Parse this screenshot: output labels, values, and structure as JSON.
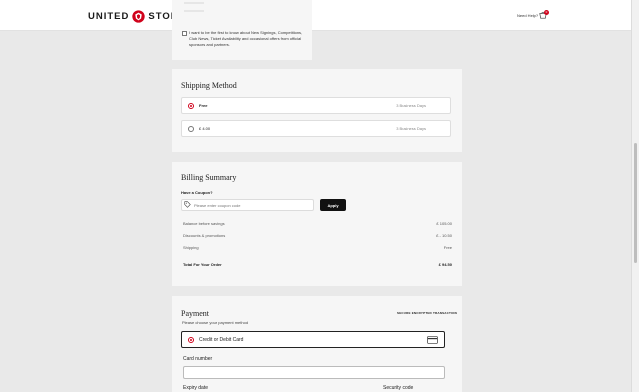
{
  "header": {
    "logo_left": "UNITED",
    "logo_right": "STORE",
    "help_label": "Need Help?",
    "basket_count": "0"
  },
  "consent": {
    "text": "I want to be the first to know about New Signings, Competitions, Club News, Ticket Availability and occasional offers from official sponsors and partners."
  },
  "shipping": {
    "title": "Shipping Method",
    "options": [
      {
        "label": "Free",
        "days": "3 Business Days",
        "selected": true
      },
      {
        "label": "£ 4.00",
        "days": "3 Business Days",
        "selected": false
      }
    ]
  },
  "billing": {
    "title": "Billing Summary",
    "coupon_label": "Have a Coupon?",
    "coupon_placeholder": "Please enter coupon code",
    "apply_label": "Apply",
    "rows": [
      {
        "label": "Balance before savings",
        "value": "£ 105.00"
      },
      {
        "label": "Discounts & promotions",
        "value": "£ - 10.50"
      },
      {
        "label": "Shipping",
        "value": "Free"
      }
    ],
    "total": {
      "label": "Total For Your Order",
      "value": "£ 94.50"
    }
  },
  "payment": {
    "title": "Payment",
    "subtitle": "Please choose your payment method",
    "secure_label": "SECURE ENCRYPTED TRANSACTION",
    "method_label": "Credit or Debit Card",
    "card_number_label": "Card number",
    "expiry_label": "Expiry date",
    "security_label": "Security code"
  },
  "colors": {
    "accent": "#d0021b",
    "button": "#111111",
    "card_bg": "#f6f6f6",
    "page_bg": "#e9e9e9"
  }
}
